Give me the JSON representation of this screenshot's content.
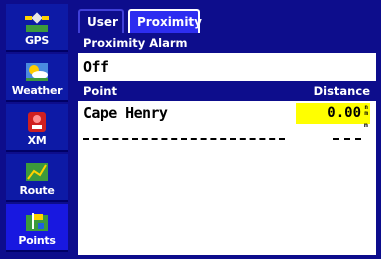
{
  "sidebar": {
    "items": [
      {
        "label": "GPS",
        "icon": "gps-satellite-icon"
      },
      {
        "label": "Weather",
        "icon": "weather-sun-cloud-icon"
      },
      {
        "label": "XM",
        "icon": "xm-radio-icon"
      },
      {
        "label": "Route",
        "icon": "route-map-icon"
      },
      {
        "label": "Points",
        "icon": "points-flag-icon",
        "active": true
      }
    ]
  },
  "tabs": [
    {
      "label": "User"
    },
    {
      "label": "Proximity",
      "active": true
    }
  ],
  "proximity_alarm": {
    "label": "Proximity Alarm",
    "value": "Off"
  },
  "table": {
    "col_point": "Point",
    "col_distance": "Distance",
    "rows": [
      {
        "point": "Cape Henry",
        "distance": "0.00",
        "unit_top": "n",
        "unit_bottom": "m"
      },
      {
        "point": "",
        "distance": "",
        "unit_top": "n",
        "unit_bottom": ""
      }
    ]
  },
  "colors": {
    "background": "#0d0d8c",
    "active_tab": "#2d2df0",
    "selection": "#ffff00"
  }
}
